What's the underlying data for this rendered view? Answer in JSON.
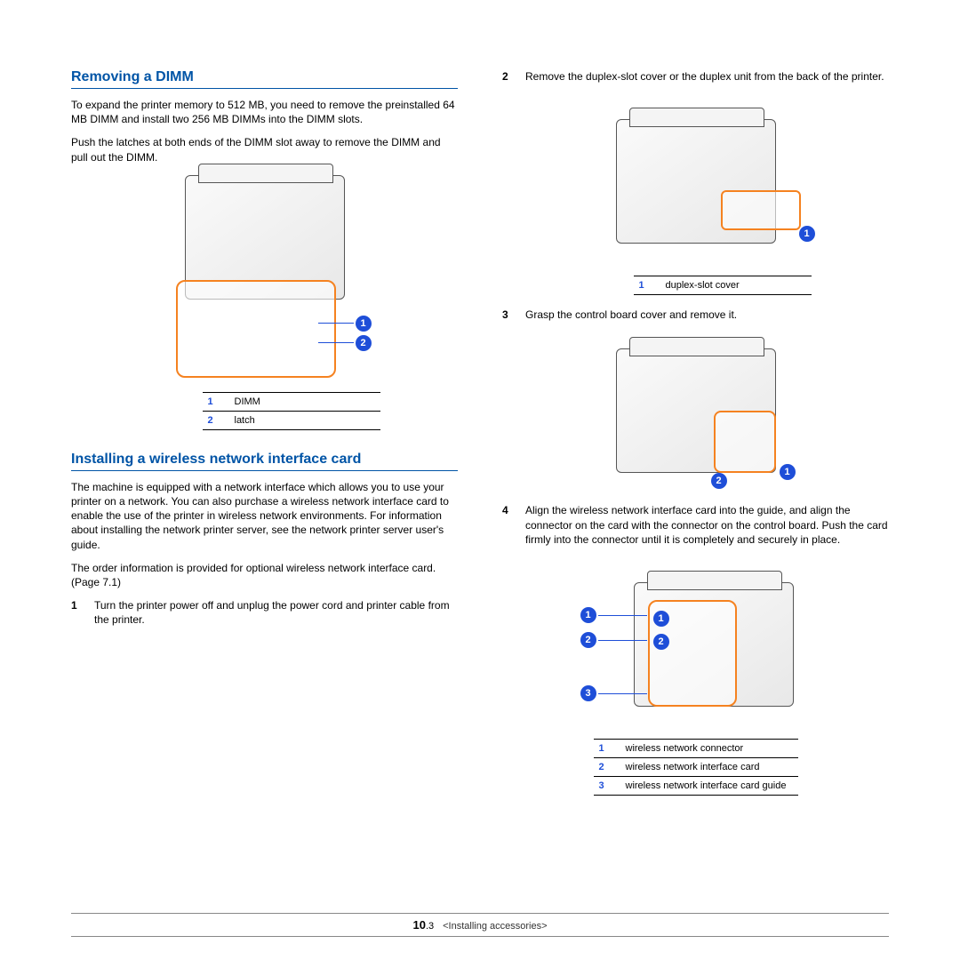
{
  "section1": {
    "heading": "Removing a DIMM",
    "p1": "To expand the printer memory to 512 MB, you need to remove the preinstalled 64 MB DIMM and install two 256 MB DIMMs into the DIMM slots.",
    "p2": "Push the latches at both ends of the DIMM slot away to remove the DIMM and pull out the DIMM.",
    "legend": [
      {
        "n": "1",
        "label": "DIMM"
      },
      {
        "n": "2",
        "label": "latch"
      }
    ]
  },
  "section2": {
    "heading": "Installing a wireless network interface card",
    "p1": "The machine is equipped with a network interface which allows you to use your printer on a network. You can also purchase a wireless network interface card to enable the use of the printer in wireless network environments. For information about installing the network printer server, see the network printer server user's guide.",
    "p2": "The order information is provided for optional wireless network interface card. (Page 7.1)",
    "step1": {
      "n": "1",
      "text": "Turn the printer power off and unplug the power cord and printer cable from the printer."
    }
  },
  "right": {
    "step2": {
      "n": "2",
      "text": "Remove the duplex-slot cover or the duplex unit from the back of the printer."
    },
    "legend2": [
      {
        "n": "1",
        "label": "duplex-slot cover"
      }
    ],
    "step3": {
      "n": "3",
      "text": "Grasp the control board cover and remove it."
    },
    "step4": {
      "n": "4",
      "text": "Align the wireless network interface card into the guide, and align the connector on the card with the connector on the control board. Push the card firmly into the connector until it is completely and securely in place."
    },
    "legend4": [
      {
        "n": "1",
        "label": "wireless network connector"
      },
      {
        "n": "2",
        "label": "wireless network interface card"
      },
      {
        "n": "3",
        "label": "wireless network interface card guide"
      }
    ]
  },
  "footer": {
    "page_main": "10",
    "page_sub": ".3",
    "section": "<Installing accessories>"
  },
  "callouts": {
    "c1": "1",
    "c2": "2",
    "c3": "3"
  }
}
